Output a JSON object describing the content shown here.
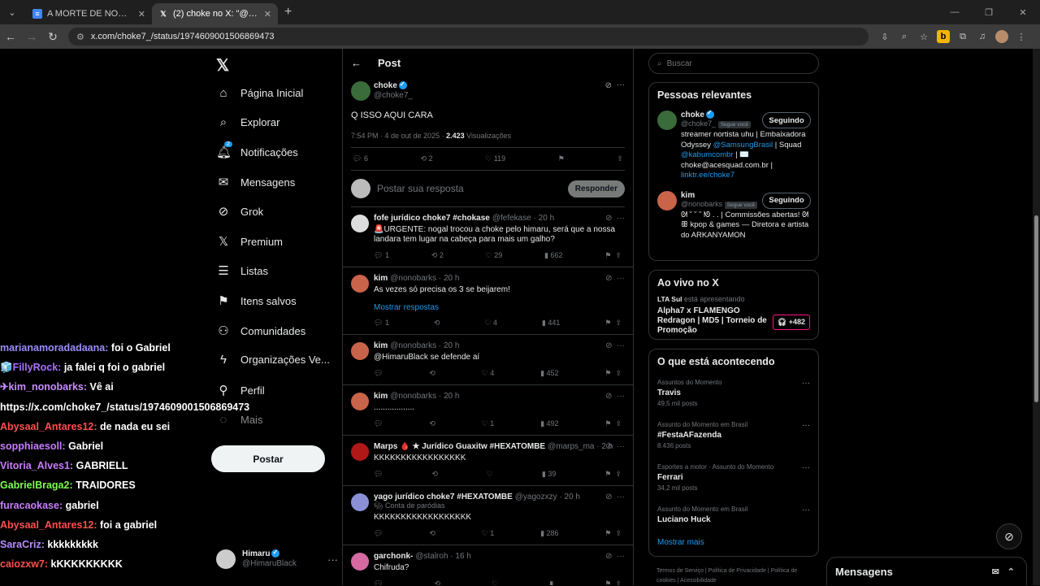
{
  "browser": {
    "tabs": [
      {
        "title": "A MORTE DE NOGAL - Docume",
        "icon": "docs-icon"
      },
      {
        "title": "(2) choke no X: \"@nonobarks C",
        "icon": "x-icon"
      }
    ],
    "url": "x.com/choke7_/status/1974609001506869473"
  },
  "nav": {
    "items": [
      {
        "label": "Página Inicial",
        "icon": "home-icon"
      },
      {
        "label": "Explorar",
        "icon": "search-icon"
      },
      {
        "label": "Notificações",
        "icon": "bell-icon",
        "badge": "2"
      },
      {
        "label": "Mensagens",
        "icon": "mail-icon"
      },
      {
        "label": "Grok",
        "icon": "grok-icon"
      },
      {
        "label": "Premium",
        "icon": "x-icon"
      },
      {
        "label": "Listas",
        "icon": "list-icon"
      },
      {
        "label": "Itens salvos",
        "icon": "bookmark-icon"
      },
      {
        "label": "Comunidades",
        "icon": "people-icon"
      },
      {
        "label": "Organizações Ve...",
        "icon": "bolt-icon"
      },
      {
        "label": "Perfil",
        "icon": "user-icon"
      },
      {
        "label": "Mais",
        "icon": "more-icon"
      }
    ],
    "post_label": "Postar",
    "account": {
      "name": "Himaru",
      "handle": "@HimaruBlack"
    }
  },
  "chat": [
    {
      "user": "marianamoradadaana:",
      "msg": "foi o Gabriel",
      "color": "#9b8cff"
    },
    {
      "user": "FillyRock:",
      "msg": "ja falei q foi o gabriel",
      "color": "#a970ff",
      "prefix": "🧊"
    },
    {
      "user": "kim_nonobarks:",
      "msg": "Vê ai",
      "color": "#c88cff",
      "prefix": "✈"
    },
    {
      "user": "",
      "msg": "https://x.com/choke7_/status/1974609001506869473",
      "color": "#ffffff"
    },
    {
      "user": "Abysaal_Antares12:",
      "msg": "de nada eu sei",
      "color": "#ff4f4f"
    },
    {
      "user": "sopphiaesoll:",
      "msg": "Gabriel",
      "color": "#c77dff"
    },
    {
      "user": "Vitoria_Alves1:",
      "msg": "GABRIELL",
      "color": "#c77dff"
    },
    {
      "user": "GabrielBraga2:",
      "msg": "TRAIDORES",
      "color": "#7cff4f"
    },
    {
      "user": "furacaokase:",
      "msg": "gabriel",
      "color": "#c77dff"
    },
    {
      "user": "Abysaal_Antares12:",
      "msg": "foi a gabriel",
      "color": "#ff4f4f"
    },
    {
      "user": "SaraCriz:",
      "msg": "kkkkkkkkk",
      "color": "#b48cff"
    },
    {
      "user": "caiozxw7:",
      "msg": "kKKKKKKKKK",
      "color": "#ff4f4f"
    }
  ],
  "main": {
    "header": "Post",
    "post": {
      "name": "choke",
      "handle": "@choke7_",
      "text": "Q ISSO AQUI CARA",
      "meta": "7:54 PM · 4 de out de 2025 · ",
      "views": "2.423",
      "views_label": "Visualizações",
      "replies": "6",
      "reposts": "2",
      "likes": "119"
    },
    "reply_placeholder": "Postar sua resposta",
    "reply_button": "Responder",
    "replies": [
      {
        "name": "fofe jurídico choke7 #chokase",
        "handle": "@fefekase · 20 h",
        "text": "🚨URGENTE: nogal trocou a choke pelo himaru, será que a nossa landara tem lugar na cabeça para mais um galho?",
        "r": "1",
        "rt": "2",
        "l": "29",
        "v": "662",
        "avc": "#ddd"
      },
      {
        "name": "kim",
        "handle": "@nonobarks · 20 h",
        "text": "As vezes só precisa os 3 se beijarem!",
        "r": "1",
        "rt": "",
        "l": "4",
        "v": "441",
        "avc": "#c9634a"
      },
      {
        "name": "kim",
        "handle": "@nonobarks · 20 h",
        "text": "@HimaruBlack se defende aí",
        "r": "",
        "rt": "",
        "l": "4",
        "v": "452",
        "avc": "#c9634a"
      },
      {
        "name": "kim",
        "handle": "@nonobarks · 20 h",
        "text": "..................",
        "r": "",
        "rt": "",
        "l": "1",
        "v": "492",
        "avc": "#c9634a"
      },
      {
        "name": "Marps 🩸 ★ Jurídico Guaxitw #HEXATOMBE",
        "handle": "@marps_ma · 2 h",
        "text": "KKKKKKKKKKKKKKKKK",
        "r": "",
        "rt": "",
        "l": "",
        "v": "39",
        "avc": "#b01818"
      },
      {
        "name": "yago jurídico choke7 #HEXATOMBE",
        "handle": "@yagozxzy · 20 h",
        "text": "KKKKKKKKKKKKKKKKKK",
        "r": "",
        "rt": "",
        "l": "1",
        "v": "286",
        "avc": "#8a8fd6"
      },
      {
        "name": "garchonk-",
        "handle": "@stalroh · 16 h",
        "text": "Chifruda?",
        "r": "",
        "rt": "",
        "l": "",
        "v": "",
        "avc": "#d46aa0"
      }
    ],
    "show_replies": "Mostrar respostas",
    "parody_label": "Conta de paródias"
  },
  "right": {
    "search_placeholder": "Buscar",
    "relevant_title": "Pessoas relevantes",
    "people": [
      {
        "name": "choke",
        "handle": "@choke7_",
        "tag": "Segue você",
        "btn": "Seguindo",
        "bio": "streamer nortista uhu | Embaixadora Odyssey ",
        "bio_link": "@SamsungBrasil",
        "bio2": " | Squad ",
        "bio_link2": "@kabumcombr",
        "bio3": " | ✉️ choke@acesquad.com.br | ",
        "bio_link3": "linktr.ee/choke7"
      },
      {
        "name": "kim",
        "handle": "@nonobarks",
        "tag": "Segue você",
        "btn": "Seguindo",
        "bio": "ᘛ ˘ ˘ ˘ ᘚ . . | Commissões abertas! ᘛ ꕥ kpop & games — Diretora e artista do ARKANYAMON"
      }
    ],
    "live_title": "Ao vivo no X",
    "live": {
      "host": "LTA Sul",
      "status": "está apresentando",
      "title": "Alpha7 x FLAMENGO Redragon | MD5 | Torneio de Promoção",
      "count": "+482"
    },
    "trends_title": "O que está acontecendo",
    "trends": [
      {
        "cat": "Assuntos do Momento",
        "name": "Travis",
        "posts": "49,5 mil posts"
      },
      {
        "cat": "Assunto do Momento em Brasil",
        "name": "#FestaAFazenda",
        "posts": "8.436 posts"
      },
      {
        "cat": "Esportes a motor · Assunto do Momento",
        "name": "Ferrari",
        "posts": "34,2 mil posts"
      },
      {
        "cat": "Assunto do Momento em Brasil",
        "name": "Luciano Huck",
        "posts": ""
      }
    ],
    "show_more": "Mostrar mais",
    "footer": "Termos de Serviço  |  Política de Privacidade  |  Política de cookies  |  Acessibilidade"
  },
  "dm_label": "Mensagens"
}
